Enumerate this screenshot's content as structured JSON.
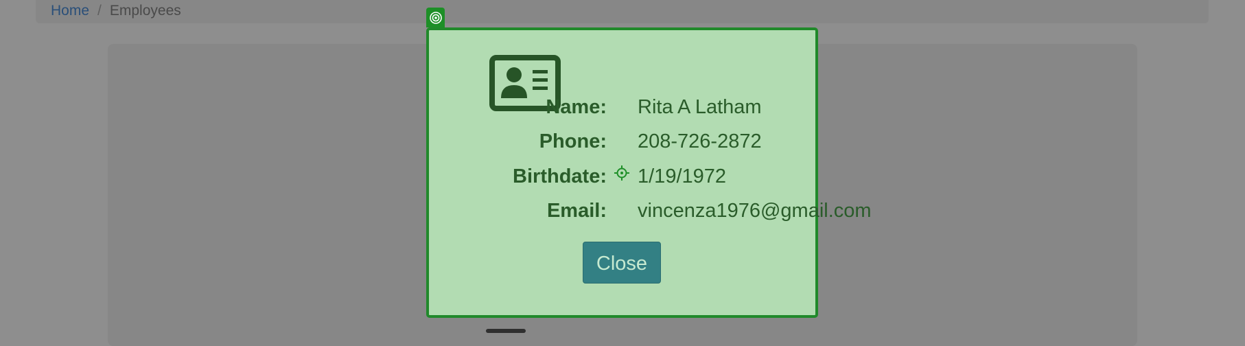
{
  "breadcrumb": {
    "home": "Home",
    "separator": "/",
    "current": "Employees"
  },
  "modal": {
    "fields": [
      {
        "label": "Name:",
        "value": "Rita A Latham"
      },
      {
        "label": "Phone:",
        "value": "208-726-2872"
      },
      {
        "label": "Birthdate:",
        "value": "1/19/1972"
      },
      {
        "label": "Email:",
        "value": "vincenza1976@gmail.com"
      }
    ],
    "close_label": "Close",
    "icon": "id-card-icon"
  },
  "colors": {
    "modal_bg": "#b2dcb2",
    "modal_border": "#20892a",
    "text": "#2a5c2a",
    "button": "#338084"
  }
}
